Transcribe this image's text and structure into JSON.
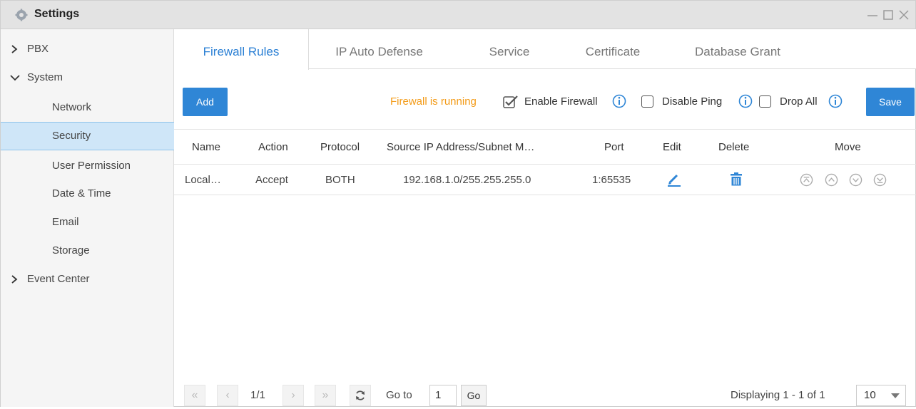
{
  "window": {
    "title": "Settings"
  },
  "sidebar": {
    "items": [
      {
        "label": "PBX",
        "expanded": false
      },
      {
        "label": "System",
        "expanded": true
      },
      {
        "label": "Network"
      },
      {
        "label": "Security",
        "active": true
      },
      {
        "label": "User Permission"
      },
      {
        "label": "Date & Time"
      },
      {
        "label": "Email"
      },
      {
        "label": "Storage"
      },
      {
        "label": "Event Center",
        "expanded": false
      }
    ]
  },
  "tabs": [
    {
      "label": "Firewall Rules",
      "active": true
    },
    {
      "label": "IP Auto Defense"
    },
    {
      "label": "Service"
    },
    {
      "label": "Certificate"
    },
    {
      "label": "Database Grant"
    }
  ],
  "toolbar": {
    "add_label": "Add",
    "status_text": "Firewall is running",
    "enable_firewall_label": "Enable Firewall",
    "enable_firewall_checked": true,
    "disable_ping_label": "Disable Ping",
    "disable_ping_checked": false,
    "drop_all_label": "Drop All",
    "drop_all_checked": false,
    "save_label": "Save"
  },
  "table": {
    "columns": [
      "Name",
      "Action",
      "Protocol",
      "Source IP Address/Subnet M…",
      "Port",
      "Edit",
      "Delete",
      "Move"
    ],
    "rows": [
      {
        "name": "Local…",
        "action": "Accept",
        "protocol": "BOTH",
        "source": "192.168.1.0/255.255.255.0",
        "port": "1:65535"
      }
    ]
  },
  "pagination": {
    "page_info": "1/1",
    "goto_label": "Go to",
    "goto_value": "1",
    "go_label": "Go",
    "display_text": "Displaying 1 - 1 of 1",
    "page_size": "10"
  },
  "colors": {
    "accent": "#2f86d6",
    "status": "#f39b18",
    "active_bg": "#cfe6f8"
  },
  "icons": [
    "settings-gear-icon",
    "minimize-icon",
    "maximize-icon",
    "close-icon",
    "chevron-right-icon",
    "chevron-down-icon",
    "info-icon",
    "edit-pencil-icon",
    "trash-icon",
    "move-top-icon",
    "move-up-icon",
    "move-down-icon",
    "move-bottom-icon",
    "first-page-icon",
    "prev-page-icon",
    "next-page-icon",
    "last-page-icon",
    "refresh-icon"
  ]
}
